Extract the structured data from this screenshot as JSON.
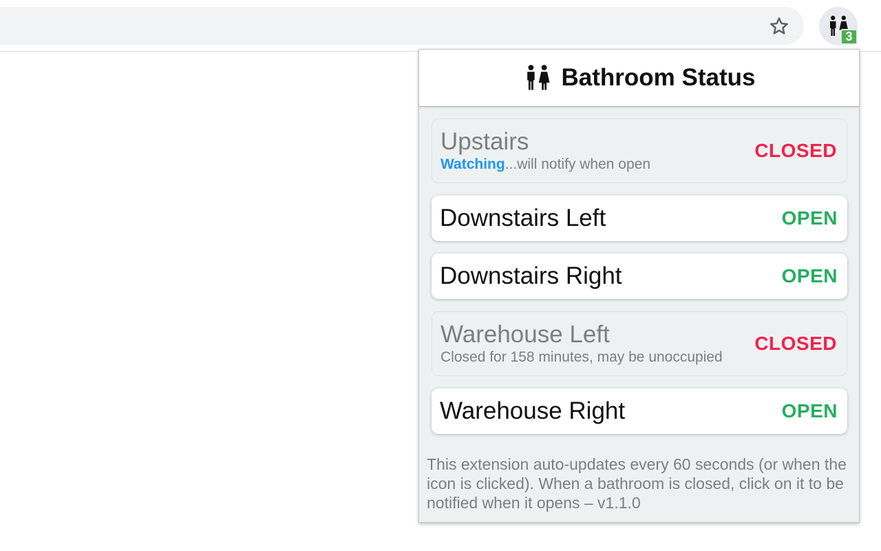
{
  "toolbar": {
    "badge_count": "3"
  },
  "icons": {
    "star": "star-outline-icon",
    "extension": "restroom-icon"
  },
  "colors": {
    "open": "#27ae60",
    "closed": "#f0224e",
    "watching": "#2196f3",
    "badge": "#4caf50"
  },
  "popup": {
    "title": "Bathroom Status",
    "bathrooms": [
      {
        "name": "Upstairs",
        "status": "CLOSED",
        "sub_highlight": "Watching",
        "sub_text": "...will notify when open"
      },
      {
        "name": "Downstairs Left",
        "status": "OPEN"
      },
      {
        "name": "Downstairs Right",
        "status": "OPEN"
      },
      {
        "name": "Warehouse Left",
        "status": "CLOSED",
        "sub_text": "Closed for 158 minutes, may be unoccupied"
      },
      {
        "name": "Warehouse Right",
        "status": "OPEN"
      }
    ],
    "footer": "This extension auto-updates every 60 seconds (or when the icon is clicked). When a bathroom is closed, click on it to be notified when it opens – v1.1.0"
  }
}
